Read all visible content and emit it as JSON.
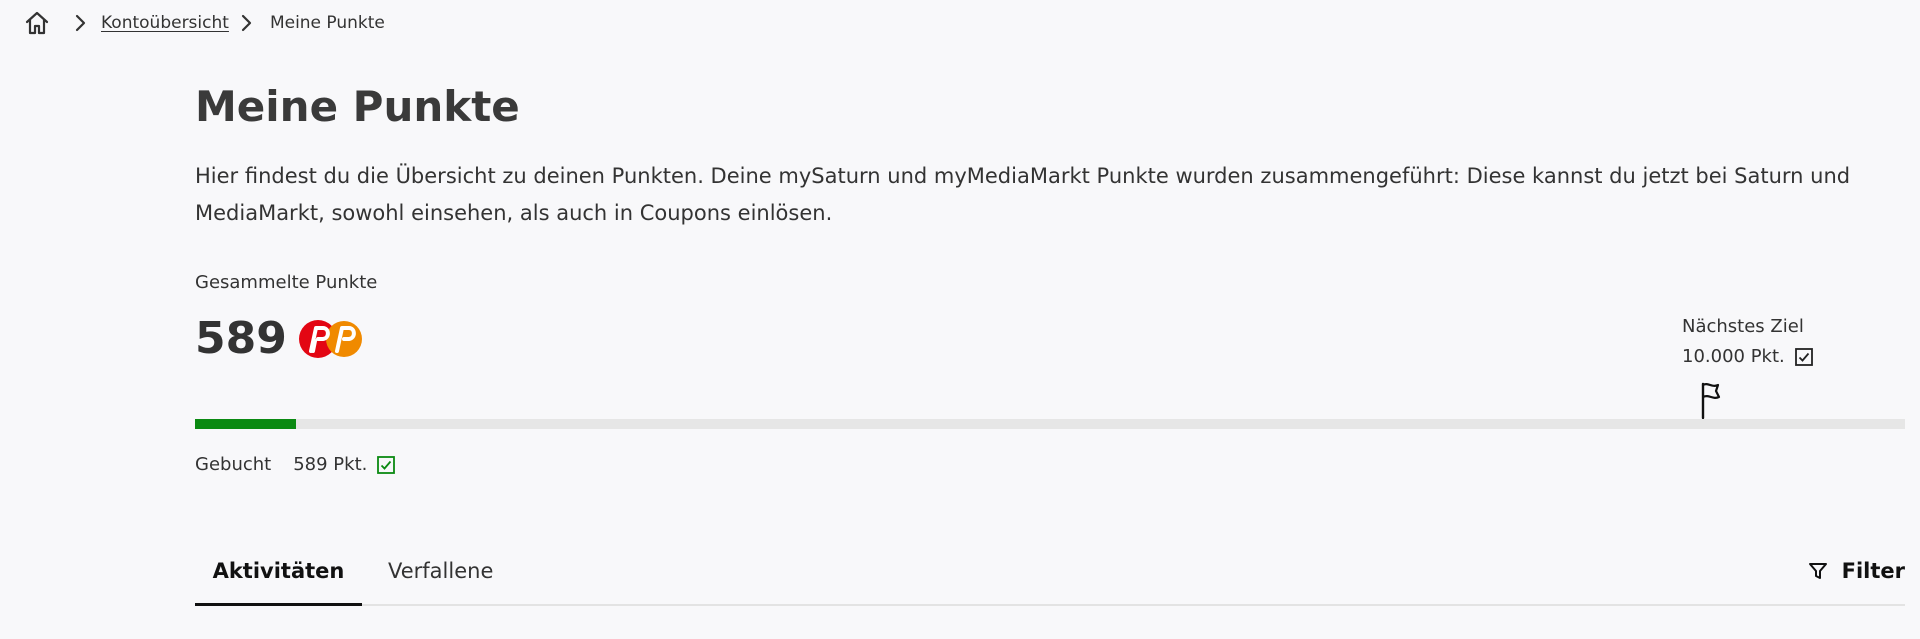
{
  "breadcrumb": {
    "home_icon": "home-icon",
    "items": [
      {
        "label": "Kontoübersicht"
      },
      {
        "label": "Meine Punkte"
      }
    ]
  },
  "page": {
    "title": "Meine Punkte",
    "intro": "Hier findest du die Übersicht zu deinen Punkten. Deine mySaturn und myMediaMarkt Punkte wurden zusammengeführt: Diese kannst du jetzt bei Saturn und MediaMarkt, sowohl einsehen, als auch in Coupons einlösen."
  },
  "points": {
    "collected_label": "Gesammelte Punkte",
    "value": "589",
    "logo_icon": "points-logo-icon",
    "next_goal_label": "Nächstes Ziel",
    "next_goal_value": "10.000 Pkt.",
    "booked_label": "Gebucht",
    "booked_value": "589 Pkt.",
    "progress_fraction": 0.0589
  },
  "tabs": [
    {
      "label": "Aktivitäten",
      "active": true
    },
    {
      "label": "Verfallene",
      "active": false
    }
  ],
  "filter": {
    "label": "Filter"
  },
  "colors": {
    "progress": "#0b8a12",
    "track": "#e6e6e6",
    "logo_red": "#e30613",
    "logo_orange": "#f08a00",
    "check_green": "#0b8a12"
  }
}
